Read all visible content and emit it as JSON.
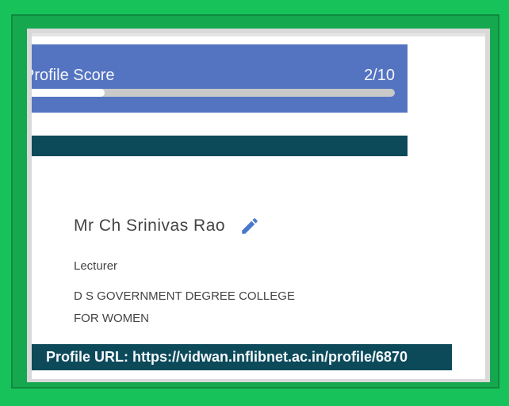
{
  "profile_score": {
    "label": "Profile Score",
    "value_text": "2/10",
    "progress_fraction": 0.2
  },
  "profile": {
    "name": "Mr Ch Srinivas Rao",
    "designation": "Lecturer",
    "institution_line1": "D S GOVERNMENT DEGREE COLLEGE",
    "institution_line2": "FOR WOMEN",
    "url_text": "Profile URL: https://vidwan.inflibnet.ac.in/profile/6870"
  },
  "icons": {
    "edit": "pencil-icon"
  },
  "colors": {
    "frame_green": "#18c25a",
    "score_blue": "#5474c1",
    "dark_teal": "#0c4a5a"
  }
}
